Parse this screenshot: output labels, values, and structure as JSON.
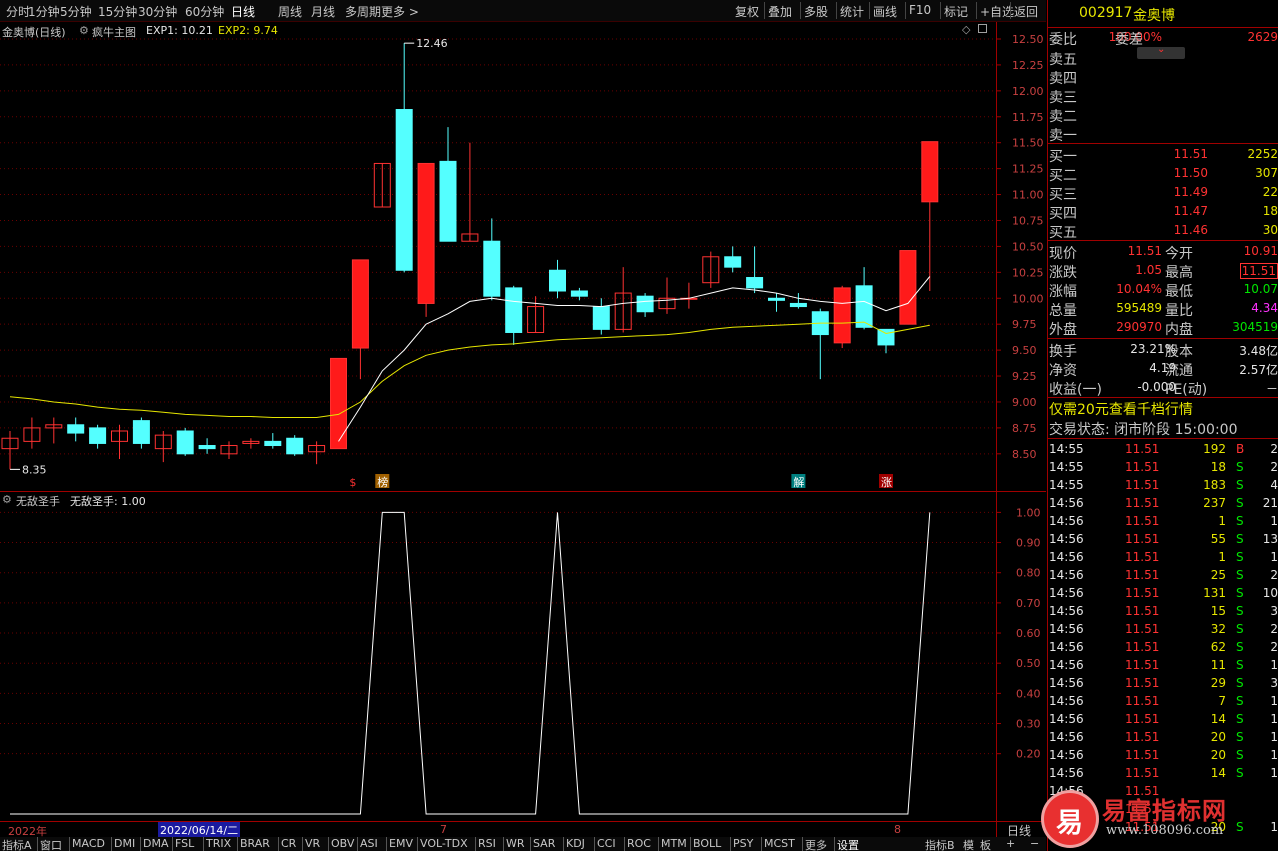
{
  "periods": [
    "分时",
    "1分钟",
    "5分钟",
    "15分钟",
    "30分钟",
    "60分钟",
    "日线",
    "周线",
    "月线",
    "多周期",
    "更多 >"
  ],
  "active_period": "日线",
  "toolbar": [
    "复权",
    "叠加",
    "多股",
    "统计",
    "画线",
    "F10",
    "标记",
    "+自选",
    "返回"
  ],
  "main_legend": {
    "stock": "金奥博(日线)",
    "indicator": "疯牛主图",
    "exp1": "EXP1: 10.21",
    "exp2": "EXP2: 9.74"
  },
  "sub_legend": {
    "name": "无敌圣手",
    "value": "无敌圣手: 1.00"
  },
  "price_axis": [
    "12.50",
    "12.25",
    "12.00",
    "11.75",
    "11.50",
    "11.25",
    "11.00",
    "10.75",
    "10.50",
    "10.25",
    "10.00",
    "9.75",
    "9.50",
    "9.25",
    "9.00",
    "8.75",
    "8.50"
  ],
  "sub_axis": [
    "1.00",
    "0.90",
    "0.80",
    "0.70",
    "0.60",
    "0.50",
    "0.40",
    "0.30",
    "0.20"
  ],
  "annotations": {
    "high": "12.46",
    "low": "8.35",
    "mark1": "$",
    "mark2": "榜",
    "mark3": "解",
    "mark4": "涨"
  },
  "date_axis": {
    "year": "2022年",
    "cursor_date": "2022/06/14/二",
    "m7": "7",
    "m8": "8",
    "period": "日线"
  },
  "bottom_tabs": [
    "指标A",
    "窗口",
    "MACD",
    "DMI",
    "DMA",
    "FSL",
    "TRIX",
    "BRAR",
    "CR",
    "VR",
    "OBV",
    "ASI",
    "EMV",
    "VOL-TDX",
    "RSI",
    "WR",
    "SAR",
    "KDJ",
    "CCI",
    "ROC",
    "MTM",
    "BOLL",
    "PSY",
    "MCST",
    "更多",
    "设置"
  ],
  "bottom_right": [
    "指标B",
    "模",
    "板",
    "+",
    "−"
  ],
  "chart_data": {
    "type": "candlestick",
    "candles": [
      {
        "o": 8.55,
        "c": 8.65,
        "h": 8.72,
        "l": 8.35
      },
      {
        "o": 8.62,
        "c": 8.75,
        "h": 8.85,
        "l": 8.55
      },
      {
        "o": 8.75,
        "c": 8.78,
        "h": 8.85,
        "l": 8.6
      },
      {
        "o": 8.78,
        "c": 8.7,
        "h": 8.85,
        "l": 8.62
      },
      {
        "o": 8.75,
        "c": 8.6,
        "h": 8.78,
        "l": 8.55
      },
      {
        "o": 8.62,
        "c": 8.72,
        "h": 8.78,
        "l": 8.45
      },
      {
        "o": 8.82,
        "c": 8.6,
        "h": 8.85,
        "l": 8.55
      },
      {
        "o": 8.55,
        "c": 8.68,
        "h": 8.72,
        "l": 8.42
      },
      {
        "o": 8.72,
        "c": 8.5,
        "h": 8.75,
        "l": 8.48
      },
      {
        "o": 8.58,
        "c": 8.55,
        "h": 8.65,
        "l": 8.5
      },
      {
        "o": 8.5,
        "c": 8.58,
        "h": 8.62,
        "l": 8.45
      },
      {
        "o": 8.6,
        "c": 8.62,
        "h": 8.65,
        "l": 8.55
      },
      {
        "o": 8.62,
        "c": 8.58,
        "h": 8.7,
        "l": 8.55
      },
      {
        "o": 8.65,
        "c": 8.5,
        "h": 8.68,
        "l": 8.48
      },
      {
        "o": 8.52,
        "c": 8.58,
        "h": 8.62,
        "l": 8.4
      },
      {
        "o": 8.55,
        "c": 9.42,
        "h": 9.42,
        "l": 8.55
      },
      {
        "o": 9.52,
        "c": 10.37,
        "h": 10.37,
        "l": 9.22
      },
      {
        "o": 10.88,
        "c": 11.3,
        "h": 11.3,
        "l": 10.88
      },
      {
        "o": 11.82,
        "c": 10.27,
        "h": 12.46,
        "l": 10.25
      },
      {
        "o": 9.95,
        "c": 11.3,
        "h": 11.3,
        "l": 9.82
      },
      {
        "o": 11.32,
        "c": 10.55,
        "h": 11.65,
        "l": 10.55
      },
      {
        "o": 10.55,
        "c": 10.62,
        "h": 11.5,
        "l": 10.55
      },
      {
        "o": 10.55,
        "c": 10.02,
        "h": 10.77,
        "l": 9.98
      },
      {
        "o": 10.1,
        "c": 9.67,
        "h": 10.12,
        "l": 9.55
      },
      {
        "o": 9.67,
        "c": 9.92,
        "h": 10.02,
        "l": 9.67
      },
      {
        "o": 10.27,
        "c": 10.07,
        "h": 10.37,
        "l": 10.0
      },
      {
        "o": 10.07,
        "c": 10.02,
        "h": 10.1,
        "l": 9.98
      },
      {
        "o": 9.92,
        "c": 9.7,
        "h": 10.0,
        "l": 9.65
      },
      {
        "o": 9.7,
        "c": 10.05,
        "h": 10.3,
        "l": 9.67
      },
      {
        "o": 10.02,
        "c": 9.87,
        "h": 10.05,
        "l": 9.82
      },
      {
        "o": 9.9,
        "c": 10.0,
        "h": 10.2,
        "l": 9.85
      },
      {
        "o": 10.0,
        "c": 10.0,
        "h": 10.15,
        "l": 9.9
      },
      {
        "o": 10.15,
        "c": 10.4,
        "h": 10.45,
        "l": 10.1
      },
      {
        "o": 10.4,
        "c": 10.3,
        "h": 10.5,
        "l": 10.25
      },
      {
        "o": 10.2,
        "c": 10.1,
        "h": 10.5,
        "l": 10.05
      },
      {
        "o": 10.0,
        "c": 9.98,
        "h": 10.05,
        "l": 9.87
      },
      {
        "o": 9.95,
        "c": 9.92,
        "h": 10.05,
        "l": 9.9
      },
      {
        "o": 9.87,
        "c": 9.65,
        "h": 9.9,
        "l": 9.22
      },
      {
        "o": 9.57,
        "c": 10.1,
        "h": 10.12,
        "l": 9.52
      },
      {
        "o": 10.12,
        "c": 9.72,
        "h": 10.3,
        "l": 9.7
      },
      {
        "o": 9.7,
        "c": 9.55,
        "h": 9.7,
        "l": 9.47
      },
      {
        "o": 9.75,
        "c": 10.46,
        "h": 10.46,
        "l": 9.75
      },
      {
        "o": 10.93,
        "c": 11.51,
        "h": 11.51,
        "l": 10.07
      }
    ],
    "exp1": [
      9.95,
      10.05,
      10.15,
      10.1,
      10.02,
      10.02,
      10.05,
      10.1,
      10.18,
      10.21
    ],
    "exp2": [
      9.74
    ],
    "signal": [
      0,
      0,
      0,
      0,
      0,
      0,
      0,
      0,
      0,
      0,
      0,
      0,
      0,
      0,
      0,
      0,
      0,
      1,
      1,
      0,
      0,
      0,
      0,
      0,
      0,
      1,
      0,
      0,
      0,
      0,
      0,
      0,
      0,
      0,
      0,
      0,
      0,
      0,
      0,
      0,
      0,
      0,
      1
    ],
    "ylim": [
      8.35,
      12.55
    ],
    "sub_ylim": [
      0,
      1.07
    ]
  },
  "quote": {
    "code": "002917",
    "name": "金奥博",
    "webi_label": "委比",
    "webi": "100.00%",
    "wecha_label": "委差",
    "wecha": "2629",
    "sells": [
      "卖五",
      "卖四",
      "卖三",
      "卖二",
      "卖一"
    ],
    "buys": [
      {
        "label": "买一",
        "price": "11.51",
        "vol": "2252"
      },
      {
        "label": "买二",
        "price": "11.50",
        "vol": "307"
      },
      {
        "label": "买三",
        "price": "11.49",
        "vol": "22"
      },
      {
        "label": "买四",
        "price": "11.47",
        "vol": "18"
      },
      {
        "label": "买五",
        "price": "11.46",
        "vol": "30"
      }
    ],
    "stats": [
      {
        "l1": "现价",
        "v1": "11.51",
        "c1": "#ff3232",
        "l2": "今开",
        "v2": "10.91",
        "c2": "#ff3232"
      },
      {
        "l1": "涨跌",
        "v1": "1.05",
        "c1": "#ff3232",
        "l2": "最高",
        "v2": "11.51",
        "c2": "#ff3232"
      },
      {
        "l1": "涨幅",
        "v1": "10.04%",
        "c1": "#ff3232",
        "l2": "最低",
        "v2": "10.07",
        "c2": "#00e600"
      },
      {
        "l1": "总量",
        "v1": "595489",
        "c1": "#e6e600",
        "l2": "量比",
        "v2": "4.34",
        "c2": "#ff32ff"
      },
      {
        "l1": "外盘",
        "v1": "290970",
        "c1": "#ff3232",
        "l2": "内盘",
        "v2": "304519",
        "c2": "#00e600"
      }
    ],
    "stats2": [
      {
        "l1": "换手",
        "v1": "23.21%",
        "l2": "股本",
        "v2": "3.48亿"
      },
      {
        "l1": "净资",
        "v1": "4.19",
        "l2": "流通",
        "v2": "2.57亿"
      },
      {
        "l1": "收益(一)",
        "v1": "-0.000",
        "l2": "PE(动)",
        "v2": "－"
      }
    ],
    "promo": "仅需20元查看千档行情",
    "trade_status": "交易状态: 闭市阶段 15:00:00",
    "ticks": [
      [
        "14:55",
        "11.51",
        "192",
        "B",
        "2"
      ],
      [
        "14:55",
        "11.51",
        "18",
        "S",
        "2"
      ],
      [
        "14:55",
        "11.51",
        "183",
        "S",
        "4"
      ],
      [
        "14:56",
        "11.51",
        "237",
        "S",
        "21"
      ],
      [
        "14:56",
        "11.51",
        "1",
        "S",
        "1"
      ],
      [
        "14:56",
        "11.51",
        "55",
        "S",
        "13"
      ],
      [
        "14:56",
        "11.51",
        "1",
        "S",
        "1"
      ],
      [
        "14:56",
        "11.51",
        "25",
        "S",
        "2"
      ],
      [
        "14:56",
        "11.51",
        "131",
        "S",
        "10"
      ],
      [
        "14:56",
        "11.51",
        "15",
        "S",
        "3"
      ],
      [
        "14:56",
        "11.51",
        "32",
        "S",
        "2"
      ],
      [
        "14:56",
        "11.51",
        "62",
        "S",
        "2"
      ],
      [
        "14:56",
        "11.51",
        "11",
        "S",
        "1"
      ],
      [
        "14:56",
        "11.51",
        "29",
        "S",
        "3"
      ],
      [
        "14:56",
        "11.51",
        "7",
        "S",
        "1"
      ],
      [
        "14:56",
        "11.51",
        "14",
        "S",
        "1"
      ],
      [
        "14:56",
        "11.51",
        "20",
        "S",
        "1"
      ],
      [
        "14:56",
        "11.51",
        "20",
        "S",
        "1"
      ],
      [
        "14:56",
        "11.51",
        "14",
        "S",
        "1"
      ],
      [
        "14:56",
        "11.51",
        "",
        "",
        ""
      ],
      [
        "14:56",
        "11.51",
        "",
        "",
        ""
      ],
      [
        "14:56",
        "11.51",
        "20",
        "S",
        "1"
      ]
    ]
  },
  "watermark": {
    "text": "易富指标网",
    "url": "www.108096.com",
    "glyph": "易"
  }
}
